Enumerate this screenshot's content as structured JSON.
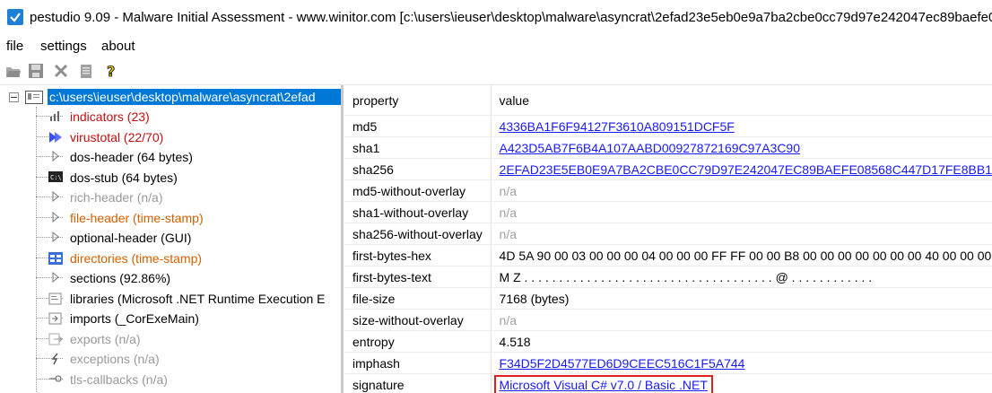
{
  "window": {
    "title": "pestudio 9.09 - Malware Initial Assessment - www.winitor.com [c:\\users\\ieuser\\desktop\\malware\\asyncrat\\2efad23e5eb0e9a7ba2cbe0cc79d97e242047ec89baefe0"
  },
  "menu": {
    "file": "file",
    "settings": "settings",
    "about": "about"
  },
  "toolbar": [
    "open-icon",
    "save-icon",
    "close-icon",
    "clipboard-icon",
    "help-icon"
  ],
  "tree": {
    "root": "c:\\users\\ieuser\\desktop\\malware\\asyncrat\\2efad",
    "items": [
      {
        "label": "indicators (23)",
        "icon": "bar-chart-icon",
        "style": "red"
      },
      {
        "label": "virustotal (22/70)",
        "icon": "virustotal-icon",
        "style": "red"
      },
      {
        "label": "dos-header (64 bytes)",
        "icon": "triangle-icon",
        "style": "normal"
      },
      {
        "label": "dos-stub (64 bytes)",
        "icon": "console-icon",
        "style": "normal"
      },
      {
        "label": "rich-header (n/a)",
        "icon": "triangle-icon",
        "style": "grey"
      },
      {
        "label": "file-header (time-stamp)",
        "icon": "triangle-icon",
        "style": "orange"
      },
      {
        "label": "optional-header (GUI)",
        "icon": "triangle-icon",
        "style": "normal"
      },
      {
        "label": "directories (time-stamp)",
        "icon": "directory-icon",
        "style": "orange"
      },
      {
        "label": "sections (92.86%)",
        "icon": "triangle-icon",
        "style": "normal"
      },
      {
        "label": "libraries (Microsoft .NET Runtime Execution E",
        "icon": "library-icon",
        "style": "normal"
      },
      {
        "label": "imports (_CorExeMain)",
        "icon": "import-icon",
        "style": "normal"
      },
      {
        "label": "exports (n/a)",
        "icon": "export-icon",
        "style": "grey"
      },
      {
        "label": "exceptions (n/a)",
        "icon": "exception-icon",
        "style": "grey"
      },
      {
        "label": "tls-callbacks (n/a)",
        "icon": "tls-icon",
        "style": "grey"
      }
    ]
  },
  "table": {
    "headers": {
      "property": "property",
      "value": "value"
    },
    "rows": [
      {
        "key": "md5",
        "value": "4336BA1F6F94127F3610A809151DCF5F",
        "kind": "link"
      },
      {
        "key": "sha1",
        "value": "A423D5AB7F6B4A107AABD00927872169C97A3C90",
        "kind": "link"
      },
      {
        "key": "sha256",
        "value": "2EFAD23E5EB0E9A7BA2CBE0CC79D97E242047EC89BAEFE08568C447D17FE8BB1",
        "kind": "link"
      },
      {
        "key": "md5-without-overlay",
        "value": "n/a",
        "kind": "na"
      },
      {
        "key": "sha1-without-overlay",
        "value": "n/a",
        "kind": "na"
      },
      {
        "key": "sha256-without-overlay",
        "value": "n/a",
        "kind": "na"
      },
      {
        "key": "first-bytes-hex",
        "value": "4D 5A 90 00 03 00 00 00 04 00 00 00 FF FF 00 00 B8 00 00 00 00 00 00 00 40 00 00 00",
        "kind": "text"
      },
      {
        "key": "first-bytes-text",
        "value": "M Z . . . . . . . . . . . . . . . . . . . . . . . . . . . . . . . . . . . . @ . . . . . . . . . . . .",
        "kind": "text"
      },
      {
        "key": "file-size",
        "value": "7168 (bytes)",
        "kind": "text"
      },
      {
        "key": "size-without-overlay",
        "value": "n/a",
        "kind": "na"
      },
      {
        "key": "entropy",
        "value": "4.518",
        "kind": "text"
      },
      {
        "key": "imphash",
        "value": "F34D5F2D4577ED6D9CEEC516C1F5A744",
        "kind": "link"
      },
      {
        "key": "signature",
        "value": "Microsoft Visual C# v7.0 / Basic .NET",
        "kind": "signature"
      }
    ]
  },
  "colors": {
    "selection": "#0078d7",
    "link": "#1a1aff",
    "red": "#c01010",
    "orange": "#d06000",
    "highlight_box": "#e02020"
  }
}
